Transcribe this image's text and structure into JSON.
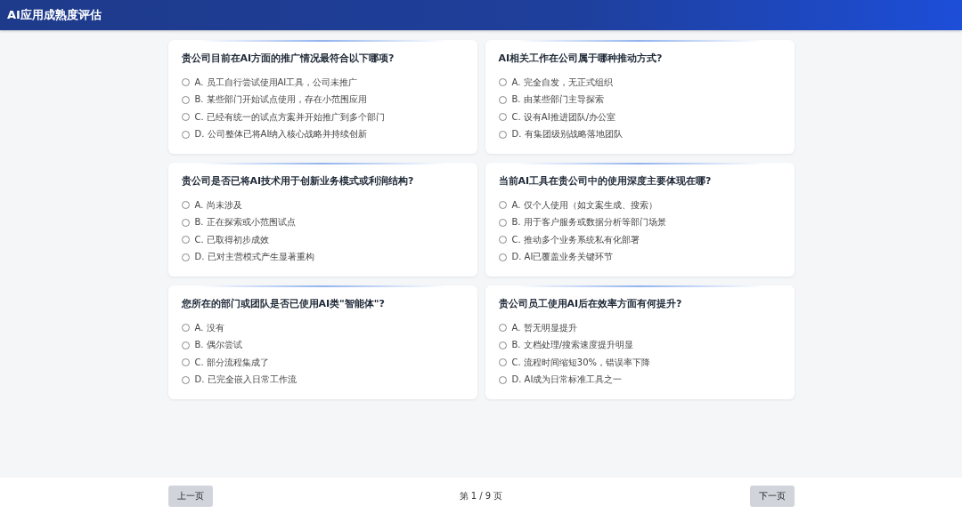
{
  "header": {
    "title": "AI应用成熟度评估"
  },
  "questions": [
    {
      "text": "贵公司目前在AI方面的推广情况最符合以下哪项?",
      "options": [
        {
          "label": "A. 员工自行尝试使用AI工具，公司未推广",
          "selected": false
        },
        {
          "label": "B. 某些部门开始试点使用，存在小范围应用",
          "selected": false
        },
        {
          "label": "C. 已经有统一的试点方案并开始推广到多个部门",
          "selected": false
        },
        {
          "label": "D. 公司整体已将AI纳入核心战略并持续创新",
          "selected": false
        }
      ]
    },
    {
      "text": "AI相关工作在公司属于哪种推动方式?",
      "options": [
        {
          "label": "A. 完全自发，无正式组织",
          "selected": false
        },
        {
          "label": "B. 由某些部门主导探索",
          "selected": false
        },
        {
          "label": "C. 设有AI推进团队/办公室",
          "selected": false
        },
        {
          "label": "D. 有集团级别战略落地团队",
          "selected": false
        }
      ]
    },
    {
      "text": "贵公司是否已将AI技术用于创新业务模式或利润结构?",
      "options": [
        {
          "label": "A. 尚未涉及",
          "selected": false
        },
        {
          "label": "B. 正在探索或小范围试点",
          "selected": false
        },
        {
          "label": "C. 已取得初步成效",
          "selected": false
        },
        {
          "label": "D. 已对主营模式产生显著重构",
          "selected": false
        }
      ]
    },
    {
      "text": "当前AI工具在贵公司中的使用深度主要体现在哪?",
      "options": [
        {
          "label": "A. 仅个人使用（如文案生成、搜索）",
          "selected": false
        },
        {
          "label": "B. 用于客户服务或数据分析等部门场景",
          "selected": false
        },
        {
          "label": "C. 推动多个业务系统私有化部署",
          "selected": false
        },
        {
          "label": "D. AI已覆盖业务关键环节",
          "selected": false
        }
      ]
    },
    {
      "text": "您所在的部门或团队是否已使用AI类\"智能体\"?",
      "options": [
        {
          "label": "A. 没有",
          "selected": false
        },
        {
          "label": "B. 偶尔尝试",
          "selected": false
        },
        {
          "label": "C. 部分流程集成了",
          "selected": false
        },
        {
          "label": "D. 已完全嵌入日常工作流",
          "selected": false
        }
      ]
    },
    {
      "text": "贵公司员工使用AI后在效率方面有何提升?",
      "options": [
        {
          "label": "A. 暂无明显提升",
          "selected": false
        },
        {
          "label": "B. 文档处理/搜索速度提升明显",
          "selected": false
        },
        {
          "label": "C. 流程时间缩短30%，错误率下降",
          "selected": false
        },
        {
          "label": "D. AI成为日常标准工具之一",
          "selected": false
        }
      ]
    }
  ],
  "footer": {
    "prev_button": "上一页",
    "page_indicator": "第 1 / 9 页",
    "next_button": "下一页"
  }
}
